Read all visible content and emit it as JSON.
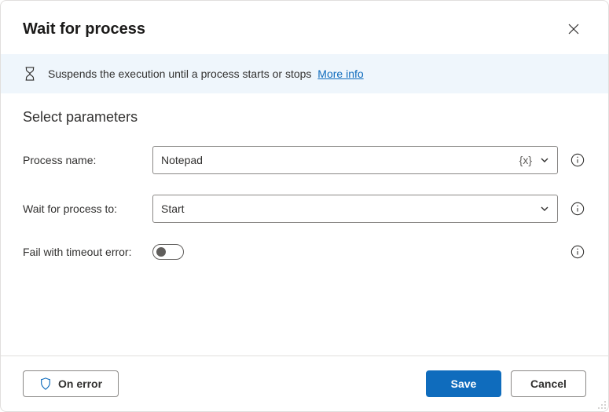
{
  "dialog": {
    "title": "Wait for process",
    "banner_text": "Suspends the execution until a process starts or stops",
    "banner_link": "More info"
  },
  "section": {
    "title": "Select parameters"
  },
  "fields": {
    "process_name": {
      "label": "Process name:",
      "value": "Notepad",
      "var_token": "{x}"
    },
    "wait_for": {
      "label": "Wait for process to:",
      "value": "Start"
    },
    "fail_timeout": {
      "label": "Fail with timeout error:",
      "enabled": false
    }
  },
  "footer": {
    "on_error": "On error",
    "save": "Save",
    "cancel": "Cancel"
  }
}
